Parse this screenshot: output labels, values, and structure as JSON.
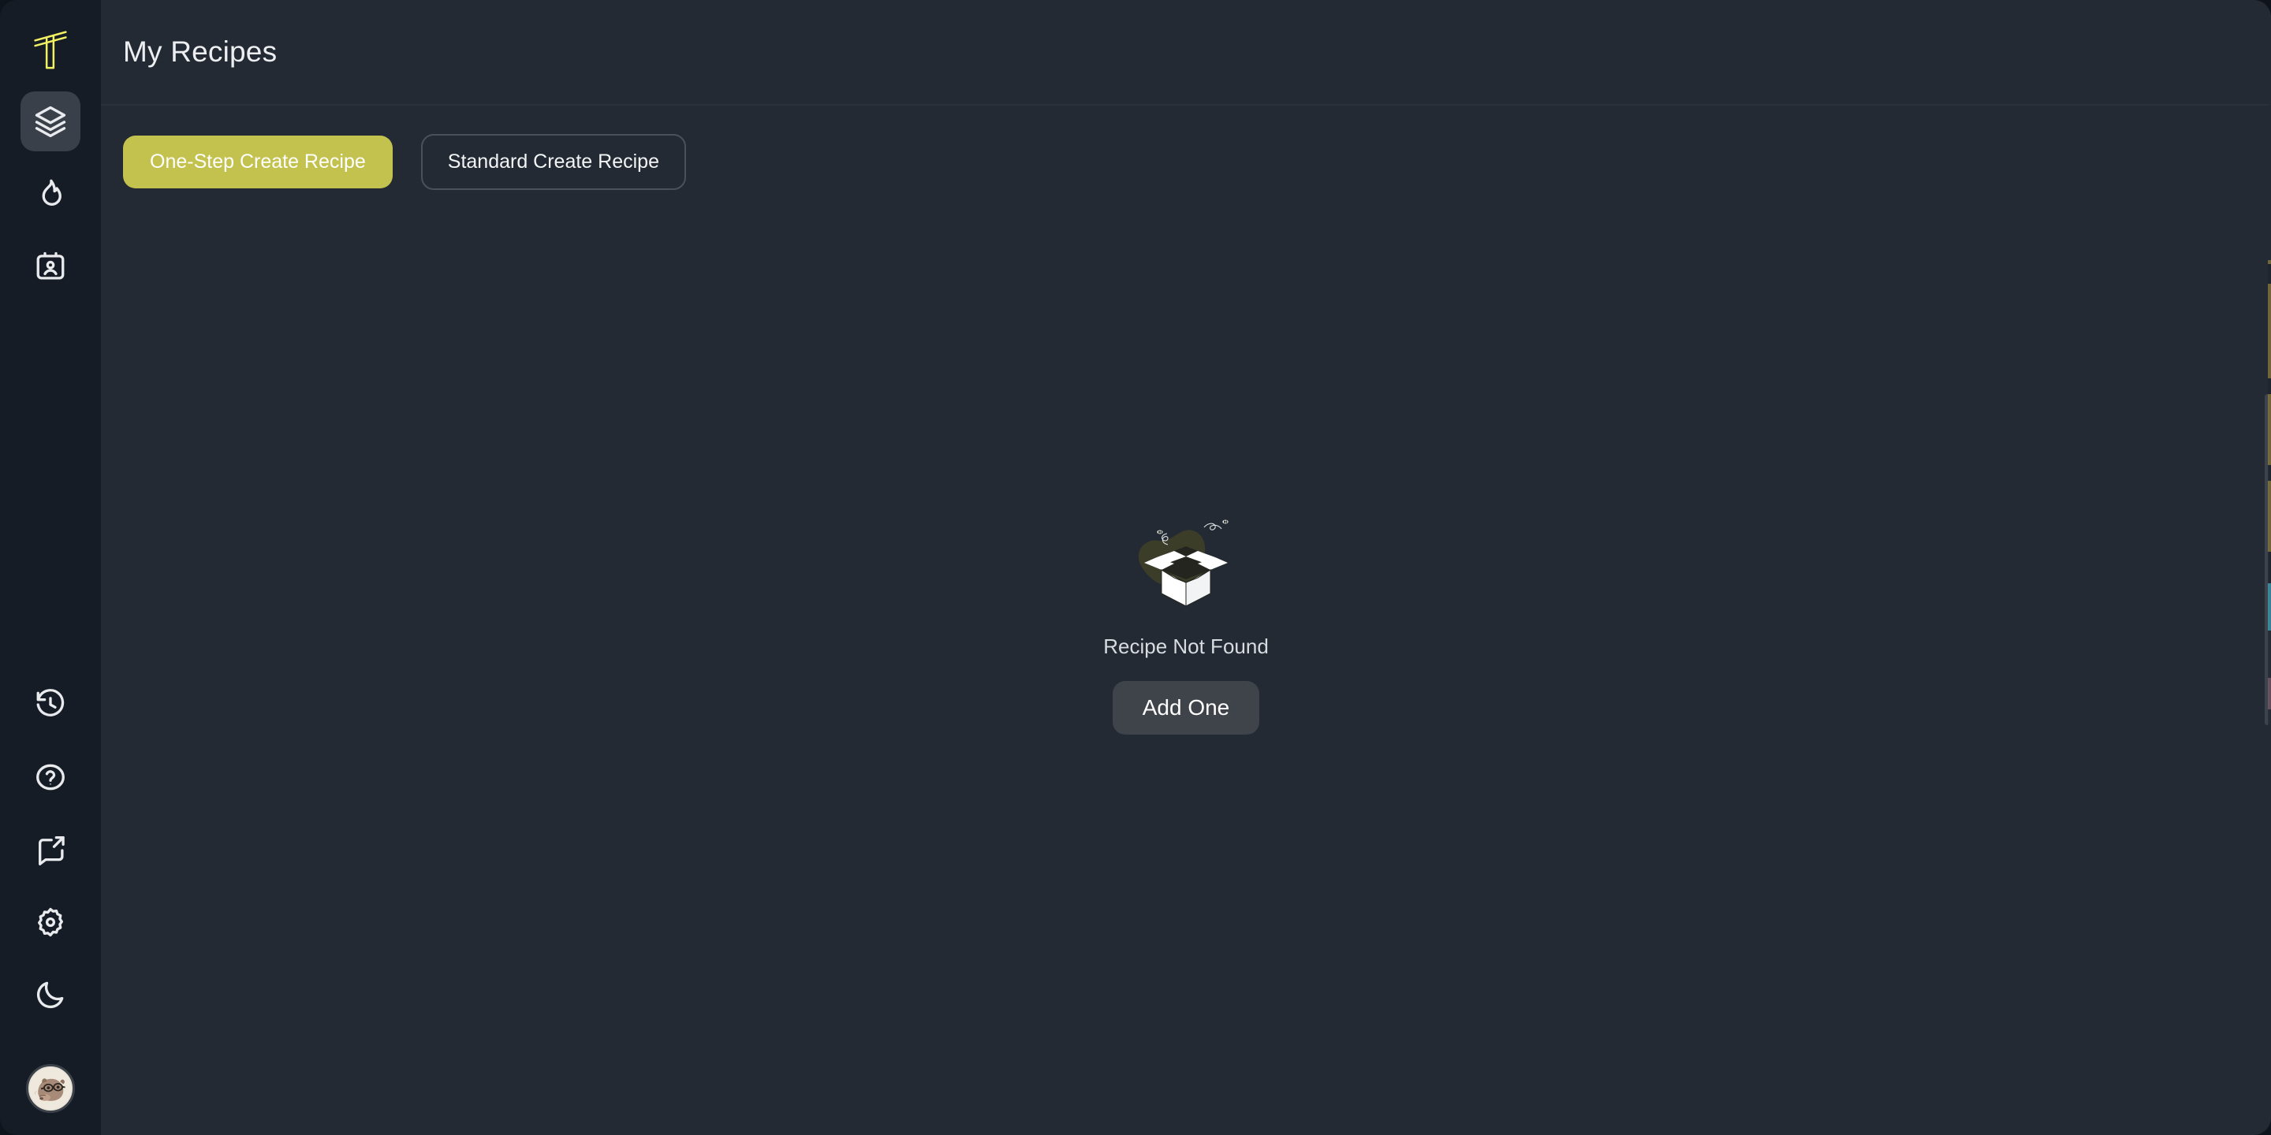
{
  "app": {
    "logo_name": "logo-t-mark",
    "accent_color": "#c4c24e",
    "sidebar_bg": "#161c26",
    "main_bg": "#242a33",
    "active_item_bg": "#3a4049"
  },
  "sidebar": {
    "top_items": [
      {
        "icon": "layers-icon",
        "name": "recipes",
        "label": "My Recipes",
        "active": true
      },
      {
        "icon": "flame-icon",
        "name": "trending",
        "label": "Trending",
        "active": false
      },
      {
        "icon": "id-card-icon",
        "name": "profile-card",
        "label": "Profile",
        "active": false
      }
    ],
    "bottom_items": [
      {
        "icon": "history-icon",
        "name": "history",
        "label": "History"
      },
      {
        "icon": "help-circle-icon",
        "name": "help",
        "label": "Help"
      },
      {
        "icon": "feedback-share-icon",
        "name": "feedback",
        "label": "Feedback"
      },
      {
        "icon": "gear-icon",
        "name": "settings",
        "label": "Settings"
      },
      {
        "icon": "moon-icon",
        "name": "theme-toggle",
        "label": "Dark Mode"
      }
    ],
    "avatar": {
      "icon": "capybara-avatar",
      "label": "User Account"
    }
  },
  "header": {
    "title": "My Recipes"
  },
  "toolbar": {
    "primary_button": "One-Step Create Recipe",
    "secondary_button": "Standard Create Recipe"
  },
  "empty_state": {
    "illustration": "empty-box-icon",
    "message": "Recipe Not Found",
    "action_button": "Add One"
  },
  "scrollbar": {
    "name": "vertical-scrollbar",
    "visible": true
  }
}
